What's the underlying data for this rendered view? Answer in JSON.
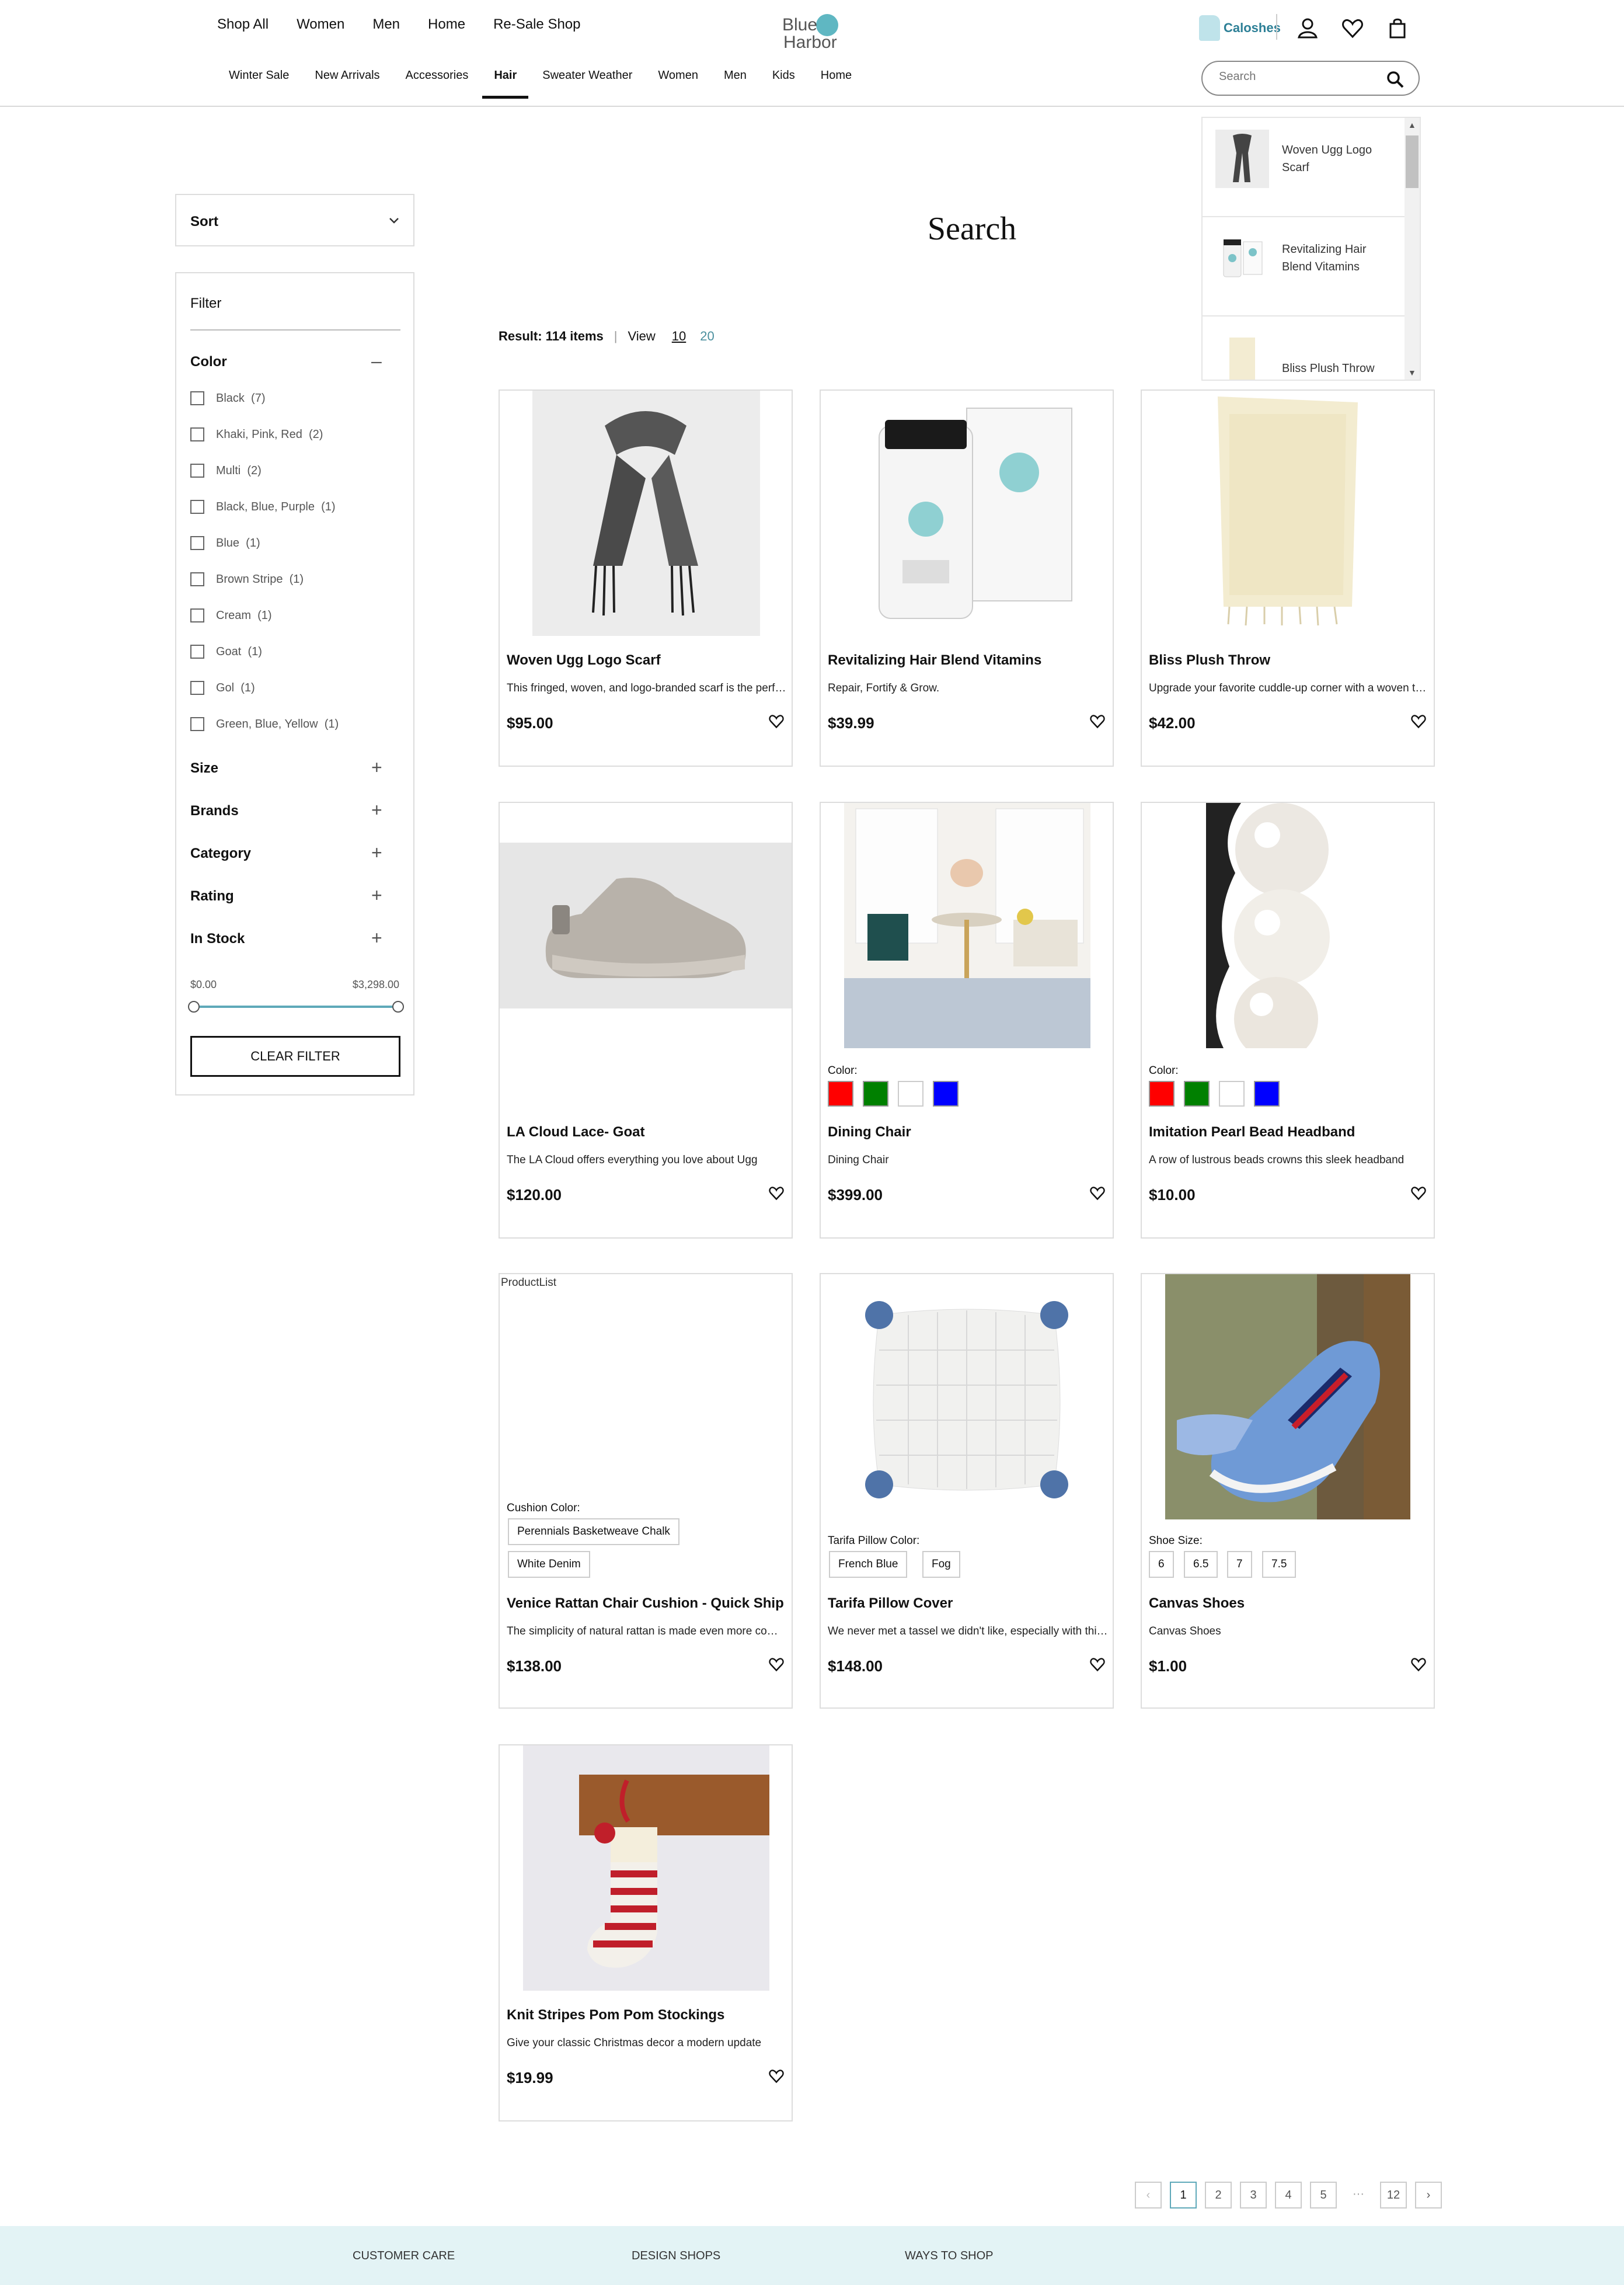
{
  "header": {
    "top_nav": [
      "Shop All",
      "Women",
      "Men",
      "Home",
      "Re-Sale Shop"
    ],
    "logo_line1": "Blue",
    "logo_line2": "Harbor",
    "brand_link": "Caloshes",
    "sub_nav": [
      "Winter Sale",
      "New Arrivals",
      "Accessories",
      "Hair",
      "Sweater Weather",
      "Women",
      "Men",
      "Kids",
      "Home"
    ],
    "active_sub_nav": "Hair",
    "search_placeholder": "Search"
  },
  "suggestions": [
    "Woven Ugg Logo Scarf",
    "Revitalizing Hair Blend Vitamins",
    "Bliss Plush Throw"
  ],
  "sidebar": {
    "sort_label": "Sort",
    "filter_title": "Filter",
    "color_title": "Color",
    "colors": [
      {
        "name": "Black",
        "count": "(7)"
      },
      {
        "name": "Khaki, Pink, Red",
        "count": "(2)"
      },
      {
        "name": "Multi",
        "count": "(2)"
      },
      {
        "name": "Black, Blue, Purple",
        "count": "(1)"
      },
      {
        "name": "Blue",
        "count": "(1)"
      },
      {
        "name": "Brown Stripe",
        "count": "(1)"
      },
      {
        "name": "Cream",
        "count": "(1)"
      },
      {
        "name": "Goat",
        "count": "(1)"
      },
      {
        "name": "Gol",
        "count": "(1)"
      },
      {
        "name": "Green, Blue, Yellow",
        "count": "(1)"
      }
    ],
    "sections": [
      "Size",
      "Brands",
      "Category",
      "Rating",
      "In Stock"
    ],
    "price_min": "$0.00",
    "price_max": "$3,298.00",
    "clear_label": "CLEAR FILTER"
  },
  "main": {
    "title": "Search",
    "result_label": "Result: 114 items",
    "view_label": "View",
    "view_options": [
      "10",
      "20"
    ]
  },
  "products": [
    {
      "name": "Woven Ugg Logo Scarf",
      "desc": "This fringed, woven, and logo-branded scarf is the perfect winter accessory",
      "price": "$95.00"
    },
    {
      "name": "Revitalizing Hair Blend Vitamins",
      "desc": "Repair, Fortify & Grow.",
      "price": "$39.99"
    },
    {
      "name": "Bliss Plush Throw",
      "desc": "Upgrade your favorite cuddle-up corner with a woven throw",
      "price": "$42.00"
    },
    {
      "name": "LA Cloud Lace- Goat",
      "desc": "The LA Cloud offers everything you love about Ugg",
      "price": "$120.00"
    },
    {
      "name": "Dining Chair",
      "desc": "Dining Chair",
      "price": "$399.00",
      "option_label": "Color:"
    },
    {
      "name": "Imitation Pearl Bead Headband",
      "desc": "A row of lustrous beads crowns this sleek headband",
      "price": "$10.00",
      "option_label": "Color:"
    },
    {
      "name": "Venice Rattan Chair Cushion - Quick Ship",
      "desc": "The simplicity of natural rattan is made even more comfortable",
      "price": "$138.00",
      "option_label": "Cushion Color:",
      "options": [
        "Perennials Basketweave Chalk",
        "White Denim"
      ],
      "placeholder": "ProductList"
    },
    {
      "name": "Tarifa Pillow Cover",
      "desc": "We never met a tassel we didn't like, especially with this one",
      "price": "$148.00",
      "option_label": "Tarifa Pillow Color:",
      "options": [
        "French Blue",
        "Fog"
      ]
    },
    {
      "name": "Canvas Shoes",
      "desc": "Canvas Shoes",
      "price": "$1.00",
      "option_label": "Shoe Size:",
      "options": [
        "6",
        "6.5",
        "7",
        "7.5"
      ]
    },
    {
      "name": "Knit Stripes Pom Pom Stockings",
      "desc": "Give your classic Christmas decor a modern update",
      "price": "$19.99"
    }
  ],
  "swatch_colors": [
    "#ff0000",
    "#008000",
    "#ffffff",
    "#0000ff"
  ],
  "pagination": {
    "prev": "‹",
    "pages": [
      "1",
      "2",
      "3",
      "4",
      "5"
    ],
    "ellipsis": "···",
    "last": "12",
    "next": "›",
    "current": "1"
  },
  "footer": [
    "CUSTOMER CARE",
    "DESIGN SHOPS",
    "WAYS TO SHOP"
  ],
  "accent_color": "#5fa9b9"
}
